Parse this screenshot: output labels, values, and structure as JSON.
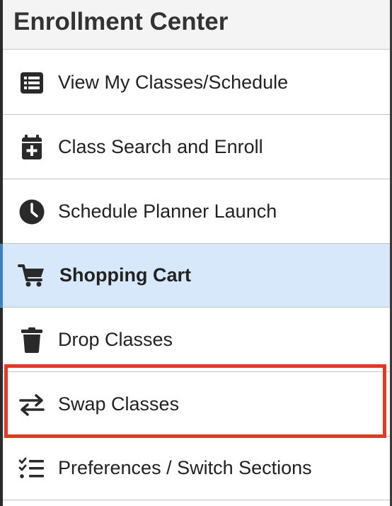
{
  "header": {
    "title": "Enrollment Center"
  },
  "menu": {
    "items": [
      {
        "label": "View My Classes/Schedule",
        "icon": "list-icon"
      },
      {
        "label": "Class Search and Enroll",
        "icon": "calendar-plus-icon"
      },
      {
        "label": "Schedule Planner Launch",
        "icon": "clock-icon"
      },
      {
        "label": "Shopping Cart",
        "icon": "shopping-cart-icon",
        "active": true
      },
      {
        "label": "Drop Classes",
        "icon": "trash-icon"
      },
      {
        "label": "Swap Classes",
        "icon": "swap-arrows-icon",
        "highlighted": true
      },
      {
        "label": "Preferences / Switch Sections",
        "icon": "checklist-icon"
      }
    ]
  },
  "colors": {
    "active_background": "#d6e8fa",
    "active_accent": "#3f7fc2",
    "highlight_border": "#e03a26",
    "header_background": "#f4f4f4"
  }
}
